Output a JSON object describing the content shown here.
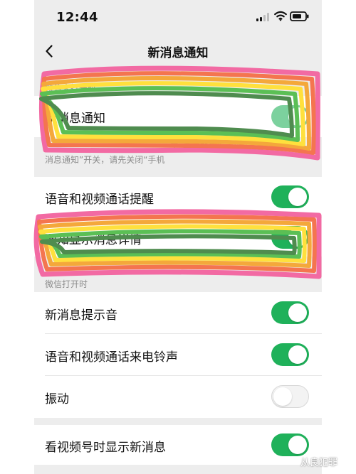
{
  "status_bar": {
    "time": "12:44",
    "icons": [
      "signal-icon",
      "wifi-icon",
      "battery-icon"
    ]
  },
  "nav": {
    "back_icon": "chevron-left-icon",
    "title": "新消息通知"
  },
  "sections": {
    "closed": {
      "label": "微信未打开时"
    },
    "open": {
      "label": "微信打开时"
    }
  },
  "rows": [
    {
      "id": "new_message_notification",
      "label": "新消息通知",
      "enabled": true
    },
    {
      "id": "voice_video_call_reminder",
      "label": "语音和视频通话提醒",
      "enabled": true
    },
    {
      "id": "show_message_details",
      "label": "通知显示消息详情",
      "enabled": true
    },
    {
      "id": "new_message_sound",
      "label": "新消息提示音",
      "enabled": true
    },
    {
      "id": "call_ringtone",
      "label": "语音和视频通话来电铃声",
      "enabled": true
    },
    {
      "id": "vibration",
      "label": "振动",
      "enabled": false
    },
    {
      "id": "show_new_messages_while_watching_channels",
      "label": "看视频号时显示新消息",
      "enabled": true
    }
  ],
  "info_text": {
    "line1": "了“手机静音”，如需设置“新",
    "line2": "消息通知”开关，请先关闭“手机"
  },
  "watermark": "从良犯罪",
  "colors": {
    "background": "#ededed",
    "card": "#ffffff",
    "primary_green": "#1fb15a",
    "text_primary": "#111111",
    "text_secondary": "#8c8c8c",
    "rainbow": [
      "#f26aa3",
      "#f4754f",
      "#f4a83b",
      "#ffe03d",
      "#5bbf55",
      "#4f8c4f"
    ]
  }
}
